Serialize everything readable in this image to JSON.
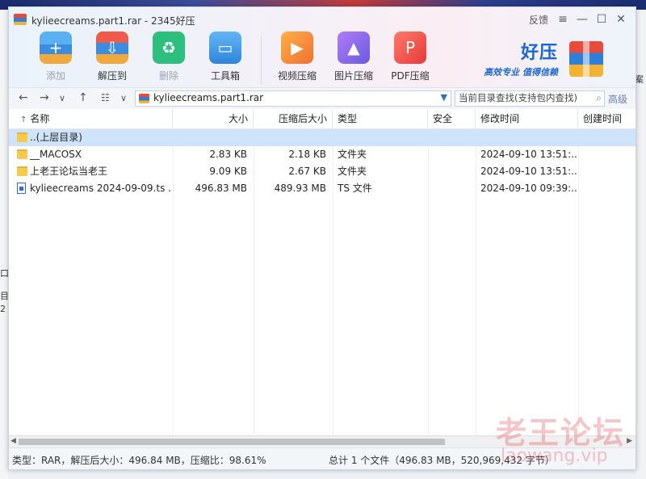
{
  "window": {
    "title": "kylieecreams.part1.rar - 2345好压"
  },
  "controls": {
    "feedback": "反馈",
    "menu": "≡",
    "minimize": "—",
    "maximize": "☐",
    "close": "✕"
  },
  "toolbar": {
    "add": "添加",
    "extract": "解压到",
    "delete": "删除",
    "tools": "工具箱",
    "video": "视频压缩",
    "image": "图片压缩",
    "pdf": "PDF压缩"
  },
  "brand": {
    "name": "好压",
    "slogan": "高效专业 值得信赖"
  },
  "address": {
    "path": "kylieecreams.part1.rar",
    "search_placeholder": "当前目录查找(支持包内查找)",
    "advanced": "高级"
  },
  "columns": [
    "名称",
    "大小",
    "压缩后大小",
    "类型",
    "安全",
    "修改时间",
    "创建时间"
  ],
  "rows": [
    {
      "name": "..(上层目录)",
      "size": "",
      "packed": "",
      "type": "",
      "modified": ""
    },
    {
      "name": "__MACOSX",
      "size": "2.83 KB",
      "packed": "2.18 KB",
      "type": "文件夹",
      "modified": "2024-09-10 13:51:..."
    },
    {
      "name": "上老王论坛当老王",
      "size": "9.09 KB",
      "packed": "2.67 KB",
      "type": "文件夹",
      "modified": "2024-09-10 13:51:..."
    },
    {
      "name": "kylieecreams 2024-09-09.ts ...",
      "size": "496.83 MB",
      "packed": "489.93 MB",
      "type": "TS 文件",
      "modified": "2024-09-10 09:39:..."
    }
  ],
  "status": {
    "left": "类型：RAR，解压后大小：496.84 MB，压缩比：98.61%",
    "right": "总计 1 个文件（496.83 MB，520,969,432 字节）"
  },
  "watermark": {
    "cn": "老王论坛",
    "url": "laowang.vip"
  },
  "colors": {
    "accent": "#2f6fd0",
    "selection": "#cfe4fb",
    "brand": "#1a66d6"
  }
}
